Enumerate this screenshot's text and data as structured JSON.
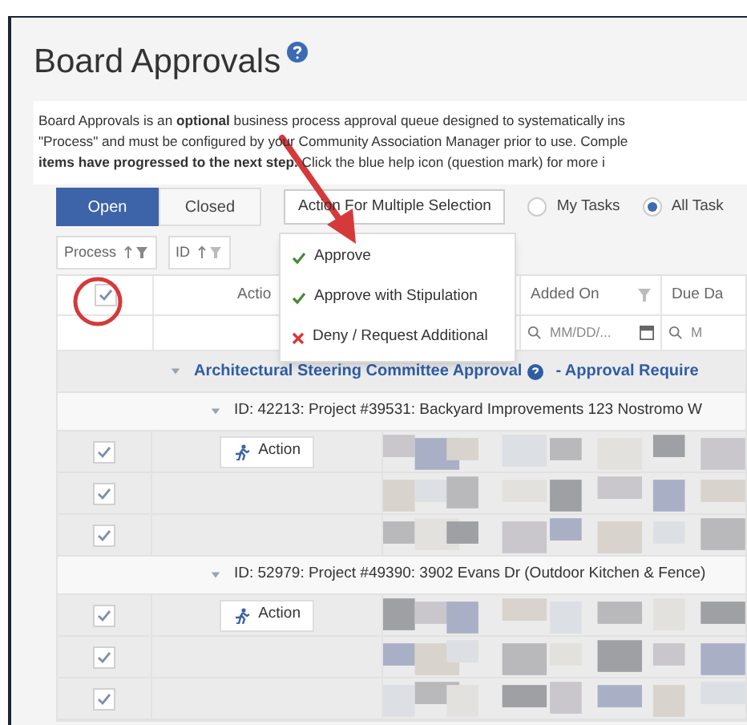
{
  "page": {
    "title": "Board Approvals"
  },
  "description": [
    {
      "text": "Board Approvals is an **optional** business process approval queue designed to systematically ins"
    },
    {
      "text": "\"Process\" and must be configured by your Community Association Manager prior to use. Comple"
    },
    {
      "text": "**items have progressed to the next step.** Click the blue help icon (question mark) for more i"
    }
  ],
  "tabs": [
    {
      "label": "Open",
      "selected": true
    },
    {
      "label": "Closed",
      "selected": false
    }
  ],
  "bulk_action": {
    "label": "Action For Multiple Selection",
    "menu": [
      {
        "label": "Approve",
        "kind": "approve"
      },
      {
        "label": "Approve with Stipulation",
        "kind": "approve"
      },
      {
        "label": "Deny / Request Additional",
        "kind": "deny"
      }
    ]
  },
  "task_filter": [
    {
      "label": "My Tasks",
      "selected": false
    },
    {
      "label": "All Task",
      "selected": true
    }
  ],
  "group_chips": [
    {
      "label": "Process"
    },
    {
      "label": "ID"
    }
  ],
  "table": {
    "select_all_checked": true,
    "columns": [
      "Actio",
      "Added On",
      "Due Da"
    ],
    "filters": [
      "MM/DD/...",
      "M"
    ],
    "group": {
      "title": "Architectural Steering Committee Approval",
      "suffix": "- Approval Require",
      "expanded": true,
      "items": [
        {
          "title": "ID: 42213: Project #39531: Backyard Improvements 123 Nostromo W",
          "expanded": true,
          "rows": [
            {
              "checked": true,
              "action": "Action"
            },
            {
              "checked": true
            },
            {
              "checked": true
            }
          ]
        },
        {
          "title": "ID: 52979: Project #49390: 3902 Evans Dr (Outdoor Kitchen & Fence)",
          "expanded": true,
          "rows": [
            {
              "checked": true,
              "action": "Action"
            },
            {
              "checked": true
            },
            {
              "checked": true
            }
          ]
        }
      ]
    }
  }
}
